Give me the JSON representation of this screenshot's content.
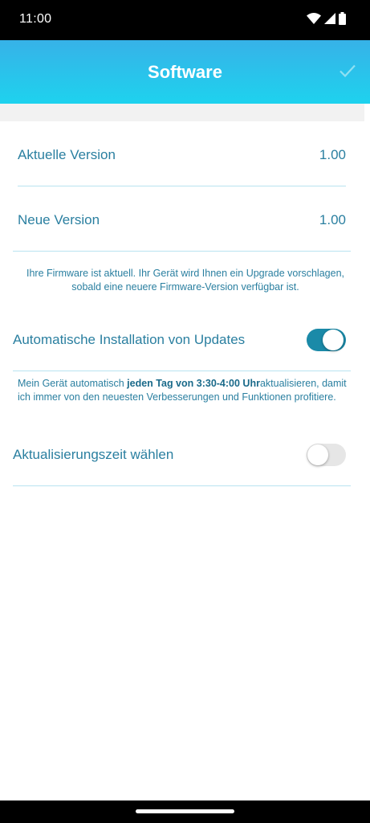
{
  "status_bar": {
    "time": "11:00",
    "icons": [
      "wifi-icon",
      "cell-signal-icon",
      "battery-icon"
    ]
  },
  "header": {
    "title": "Software",
    "confirm_icon": "check-icon"
  },
  "versions": {
    "current_label": "Aktuelle Version",
    "current_value": "1.00",
    "new_label": "Neue Version",
    "new_value": "1.00"
  },
  "firmware_note": "Ihre Firmware ist aktuell. Ihr Gerät wird Ihnen ein Upgrade vorschlagen, sobald eine neuere Firmware-Version verfügbar ist.",
  "auto_install": {
    "label": "Automatische Installation von Updates",
    "enabled": true,
    "desc_prefix": "Mein Gerät automatisch ",
    "desc_bold": "jeden Tag von 3:30-4:00 Uhr",
    "desc_suffix": "aktualisieren, damit ich immer von den neuesten Verbesserungen und Funktionen profitiere."
  },
  "update_time": {
    "label": "Aktualisierungszeit wählen",
    "enabled": false
  },
  "colors": {
    "header_gradient_top": "#37b2e8",
    "header_gradient_bottom": "#1ed2ee",
    "text_primary": "#2a7fa0",
    "switch_on": "#1b8aa8",
    "switch_off": "#e6e6e6",
    "divider": "#b9e3f0"
  }
}
